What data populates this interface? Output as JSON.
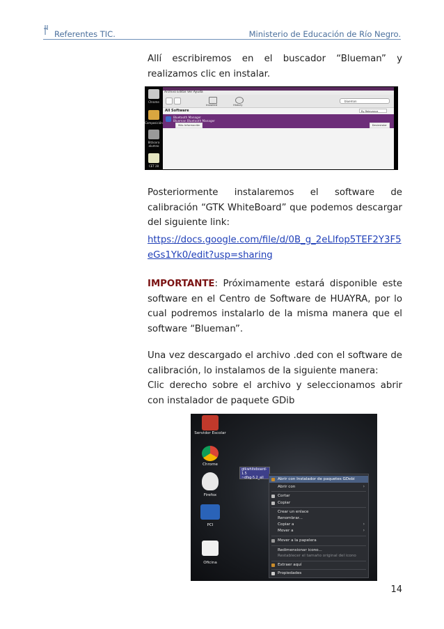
{
  "header": {
    "left": "Referentes TIC.",
    "right": "Ministerio de Educación de Río Negro."
  },
  "paragraphs": {
    "p1": "Allí escribiremos en el buscador “Blueman” y realizamos clic en instalar.",
    "p2": "Posteriormente instalaremos el software de calibración “GTK WhiteBoard” que podemos descargar del siguiente link:",
    "link": "https://docs.google.com/file/d/0B_g_2eLlfop5TEF2Y3F5eGs1Yk0/edit?usp=sharing",
    "important_label": "IMPORTANTE",
    "important_text": ": Próximamente estará disponible este software en el Centro de Software de HUAYRA, por lo cual podremos instalarlo de la misma manera que el software “Blueman”.",
    "p4": "Una vez descargado el archivo .ded con el software de calibración, lo instalamos de la siguiente manera:",
    "p5": "Clic derecho sobre el archivo y seleccionamos abrir con instalador de paquete GDib"
  },
  "screenshot1": {
    "desktop_icons": [
      "Chrome",
      "Composición",
      "Bitácora alumno",
      "CET 28"
    ],
    "menu": "Archivo  Editar  Ver  Ayuda",
    "toolbar": [
      "Installed",
      "History"
    ],
    "search_value": "blueman",
    "section_title": "All Software",
    "sort_label": "By Relevance",
    "app_name": "Bluetooth Manager",
    "app_desc": "Blueman Bluetooth Manager",
    "more_info_button": "Más Información",
    "install_button": "Desinstalar"
  },
  "screenshot2": {
    "desktop_icons": [
      "Servidor Escolar",
      "Chrome",
      "Firefox",
      "PCI",
      "Oficina"
    ],
    "file_label_1": "gtkwhiteboard-1.5",
    "file_label_2": "~dfsg-5.2_all",
    "menu_items": [
      "Abrir con Instalador de paquetes GDebi",
      "Abrir con",
      "Cortar",
      "Copiar",
      "Crear un enlace",
      "Renombrar...",
      "Copiar a",
      "Mover a",
      "Mover a la papelera",
      "Redimensionar icono...",
      "Restablecer el tamaño original del icono",
      "Extraer aquí",
      "Propiedades"
    ]
  },
  "page_number": "14",
  "colors": {
    "header_blue": "#4a6f9c",
    "link_blue": "#1f3fb8",
    "important_red": "#7a1212",
    "software_center_purple": "#6d2e79"
  }
}
